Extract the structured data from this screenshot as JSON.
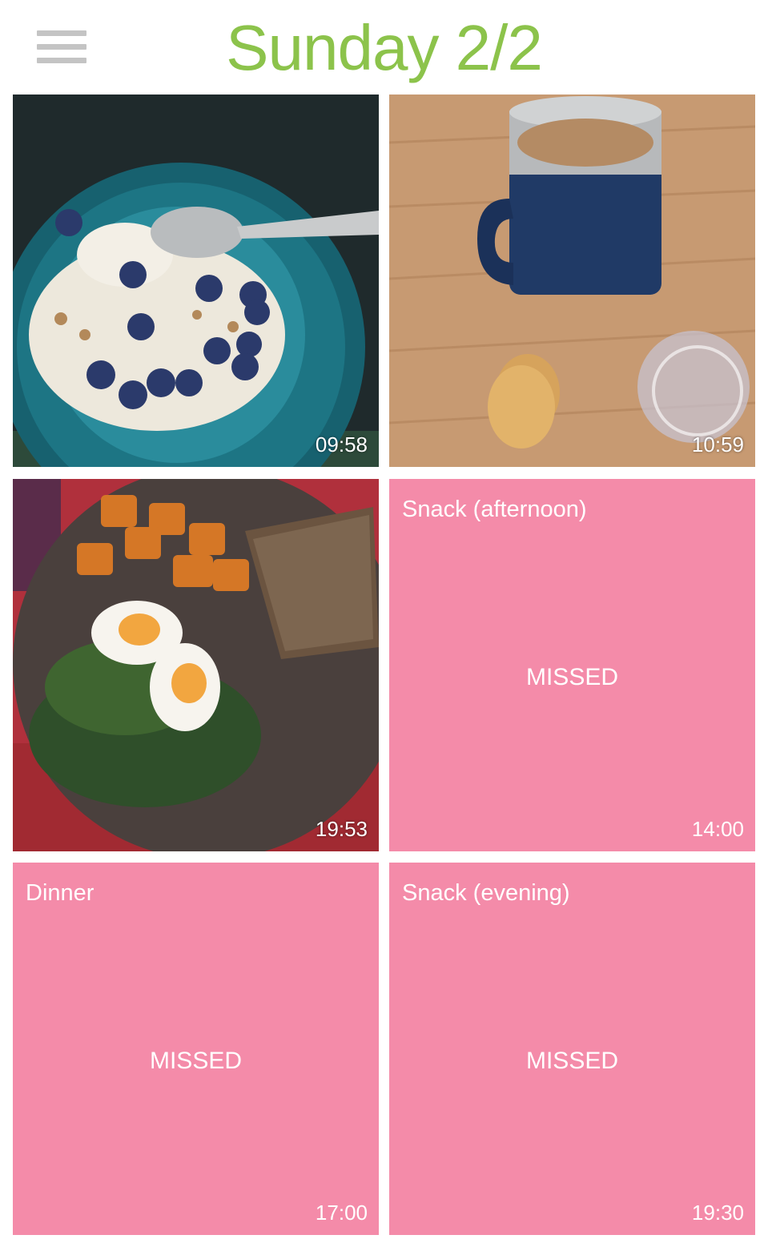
{
  "header": {
    "title": "Sunday 2/2",
    "title_color": "#8cc34b",
    "menu_icon": "hamburger-menu-icon"
  },
  "tiles": [
    {
      "kind": "photo",
      "photo": "yogurt bowl with blueberries",
      "time": "09:58"
    },
    {
      "kind": "photo",
      "photo": "coffee mug with cookies",
      "time": "10:59"
    },
    {
      "kind": "photo",
      "photo": "salad with eggs, sweet potatoes and toast",
      "time": "19:53"
    },
    {
      "kind": "missed",
      "label": "Snack (afternoon)",
      "status": "MISSED",
      "time": "14:00"
    },
    {
      "kind": "missed",
      "label": "Dinner",
      "status": "MISSED",
      "time": "17:00"
    },
    {
      "kind": "missed",
      "label": "Snack (evening)",
      "status": "MISSED",
      "time": "19:30"
    }
  ],
  "colors": {
    "missed_bg": "#f48ba9",
    "accent": "#8cc34b"
  }
}
